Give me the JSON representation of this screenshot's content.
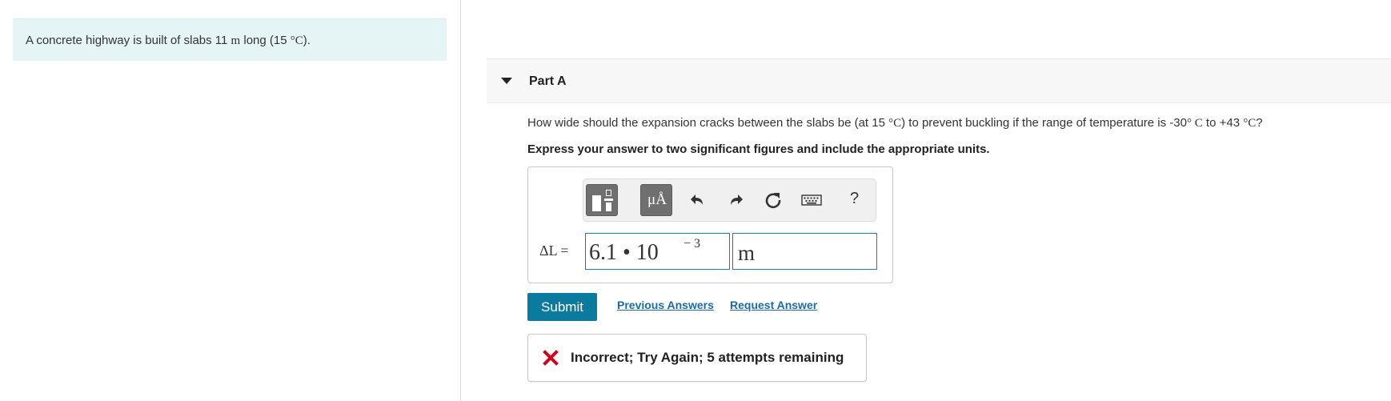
{
  "problem": {
    "text_before": "A concrete highway is built of slabs 11 ",
    "length_unit": "m",
    "text_mid": " long (15 ",
    "temp_unit": "°C",
    "text_after": ")."
  },
  "part": {
    "title": "Part A",
    "caret_icon": "caret-down-icon"
  },
  "question": {
    "text1": "How wide should the expansion cracks between the slabs be (at 15 ",
    "unit1": "°C",
    "text2": ") to prevent buckling if the range of temperature is -30",
    "unit2": "° C",
    "text3": " to +43 ",
    "unit3": "°C",
    "text4": "?"
  },
  "instruction": "Express your answer to two significant figures and include the appropriate units.",
  "toolbar": {
    "template_button": "templates-icon",
    "units_label": "μÅ",
    "undo": "undo-icon",
    "redo": "redo-icon",
    "reset": "reset-icon",
    "keyboard": "keyboard-icon",
    "help_label": "?"
  },
  "answer": {
    "variable_label": "ΔL =",
    "value": "6.1 • 10",
    "exponent": "− 3",
    "unit": "m"
  },
  "actions": {
    "submit_label": "Submit",
    "previous_answers_label": "Previous Answers",
    "request_answer_label": "Request Answer"
  },
  "feedback": {
    "icon": "x-mark-icon",
    "message": "Incorrect; Try Again; 5 attempts remaining",
    "icon_color": "#d0021b"
  },
  "colors": {
    "accent": "#0a7a9e",
    "link": "#1e6aa8",
    "problem_bg": "#e5f4f4"
  }
}
